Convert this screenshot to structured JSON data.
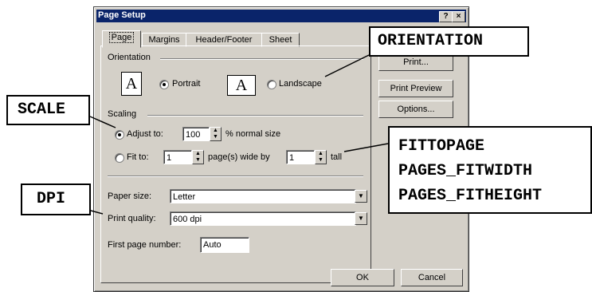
{
  "dialog": {
    "title": "Page Setup",
    "help_label": "?",
    "close_label": "×"
  },
  "tabs": [
    "Page",
    "Margins",
    "Header/Footer",
    "Sheet"
  ],
  "orientation": {
    "label": "Orientation",
    "portrait": "Portrait",
    "landscape": "Landscape",
    "selected": "portrait",
    "icon_letter": "A"
  },
  "scaling": {
    "label": "Scaling",
    "adjust_to": "Adjust to:",
    "adjust_value": "100",
    "adjust_suffix": "% normal size",
    "fit_to": "Fit to:",
    "wide_value": "1",
    "wide_suffix": "page(s) wide by",
    "tall_value": "1",
    "tall_suffix": "tall"
  },
  "paper": {
    "size_label": "Paper size:",
    "size_value": "Letter",
    "quality_label": "Print quality:",
    "quality_value": "600 dpi",
    "first_page_label": "First page number:",
    "first_page_value": "Auto"
  },
  "side_buttons": {
    "print": "Print...",
    "preview": "Print Preview",
    "options": "Options..."
  },
  "footer_buttons": {
    "ok": "OK",
    "cancel": "Cancel"
  },
  "callouts": {
    "orientation": "ORIENTATION",
    "scale": "SCALE",
    "dpi": "DPI",
    "fit_lines": [
      "FITTOPAGE",
      "PAGES_FITWIDTH",
      "PAGES_FITHEIGHT"
    ]
  }
}
